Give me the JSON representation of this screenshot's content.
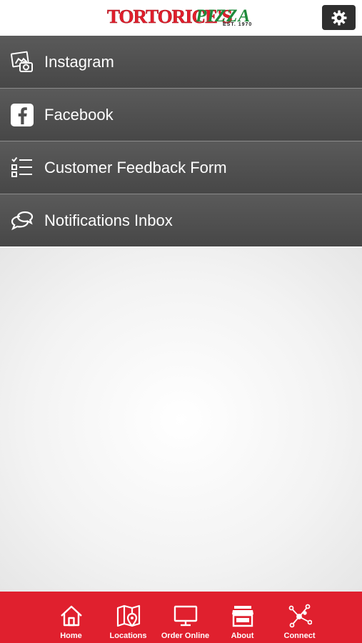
{
  "header": {
    "logo_main": "TORTORICE'S",
    "logo_script": "PIZZA",
    "logo_est": "EST. 1970",
    "settings_icon": "gear-icon"
  },
  "menu": {
    "items": [
      {
        "label": "Instagram",
        "icon": "instagram-photo-icon"
      },
      {
        "label": "Facebook",
        "icon": "facebook-icon"
      },
      {
        "label": "Customer Feedback Form",
        "icon": "checklist-icon"
      },
      {
        "label": "Notifications Inbox",
        "icon": "chat-bubbles-icon"
      }
    ]
  },
  "tabbar": {
    "tabs": [
      {
        "label": "Home",
        "icon": "home-icon"
      },
      {
        "label": "Locations",
        "icon": "map-pin-icon"
      },
      {
        "label": "Order Online",
        "icon": "monitor-icon"
      },
      {
        "label": "About",
        "icon": "storefront-icon"
      },
      {
        "label": "Connect",
        "icon": "network-icon"
      }
    ]
  },
  "colors": {
    "brand_red": "#e0202e",
    "brand_green": "#1f8a3b",
    "menu_bg": "#4f4f4f",
    "settings_bg": "#2f2f2f"
  }
}
